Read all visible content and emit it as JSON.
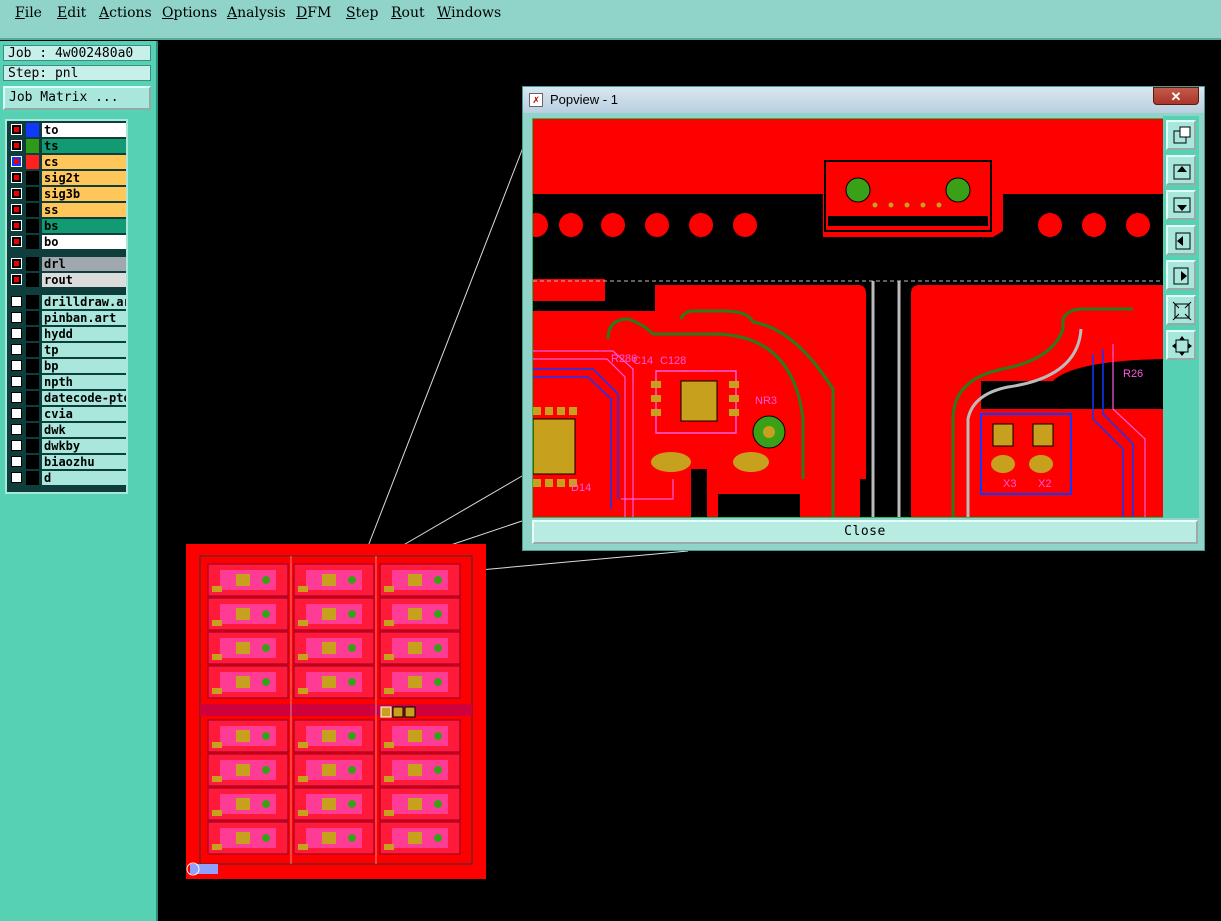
{
  "menu": [
    "File",
    "Edit",
    "Actions",
    "Options",
    "Analysis",
    "DFM",
    "Step",
    "Rout",
    "Windows"
  ],
  "job_label": "Job : 4w002480a0",
  "step_label": "Step: pnl",
  "job_matrix_button": "Job Matrix ...",
  "layers": [
    {
      "name": "to",
      "color": "#1038ff",
      "bg": "#ffffff",
      "active": true
    },
    {
      "name": "ts",
      "color": "#2d9a1a",
      "bg": "#129a73",
      "active": true
    },
    {
      "name": "cs",
      "color": "#ff2020",
      "bg": "#ffc65a",
      "active": true,
      "work": true
    },
    {
      "name": "sig2t",
      "color": "#000000",
      "bg": "#ffc65a",
      "active": true
    },
    {
      "name": "sig3b",
      "color": "#000000",
      "bg": "#ffc65a",
      "active": true
    },
    {
      "name": "ss",
      "color": "#000000",
      "bg": "#ffc65a",
      "active": true
    },
    {
      "name": "bs",
      "color": "#000000",
      "bg": "#129a73",
      "active": true
    },
    {
      "name": "bo",
      "color": "#000000",
      "bg": "#ffffff",
      "active": true
    },
    {
      "name": "drl",
      "color": "#000000",
      "bg": "#9fa8ae",
      "active": true
    },
    {
      "name": "rout",
      "color": "#000000",
      "bg": "#dcdcdc",
      "active": true
    },
    {
      "name": "drilldraw.art",
      "color": "#000000",
      "bg": "#a9e6dc",
      "active": false
    },
    {
      "name": "pinban.art",
      "color": "#000000",
      "bg": "#a9e6dc",
      "active": false
    },
    {
      "name": "hydd",
      "color": "#000000",
      "bg": "#a9e6dc",
      "active": false
    },
    {
      "name": "tp",
      "color": "#000000",
      "bg": "#a9e6dc",
      "active": false
    },
    {
      "name": "bp",
      "color": "#000000",
      "bg": "#a9e6dc",
      "active": false
    },
    {
      "name": "npth",
      "color": "#000000",
      "bg": "#a9e6dc",
      "active": false
    },
    {
      "name": "datecode-pto",
      "color": "#000000",
      "bg": "#a9e6dc",
      "active": false
    },
    {
      "name": "cvia",
      "color": "#000000",
      "bg": "#a9e6dc",
      "active": false
    },
    {
      "name": "dwk",
      "color": "#000000",
      "bg": "#a9e6dc",
      "active": false
    },
    {
      "name": "dwkby",
      "color": "#000000",
      "bg": "#a9e6dc",
      "active": false
    },
    {
      "name": "biaozhu",
      "color": "#000000",
      "bg": "#a9e6dc",
      "active": false
    },
    {
      "name": "d",
      "color": "#000000",
      "bg": "#a9e6dc",
      "active": false
    }
  ],
  "popview": {
    "title": "Popview - 1",
    "close_x": "✕",
    "close_button": "Close",
    "tools": [
      "zoom-home-icon",
      "zoom-up-icon",
      "zoom-down-icon",
      "pan-left-icon",
      "pan-right-icon",
      "zoom-fit-icon",
      "zoom-center-icon"
    ],
    "labels": [
      "C128",
      "NR3",
      "R286",
      "R26",
      "X3",
      "X2",
      "C14",
      "D14"
    ]
  },
  "colors": {
    "copper": "#ff0000",
    "pad": "#3aa018",
    "smd": "#c7a01e",
    "silk": "#ff5ae0",
    "trace": "#2b7a1c"
  }
}
